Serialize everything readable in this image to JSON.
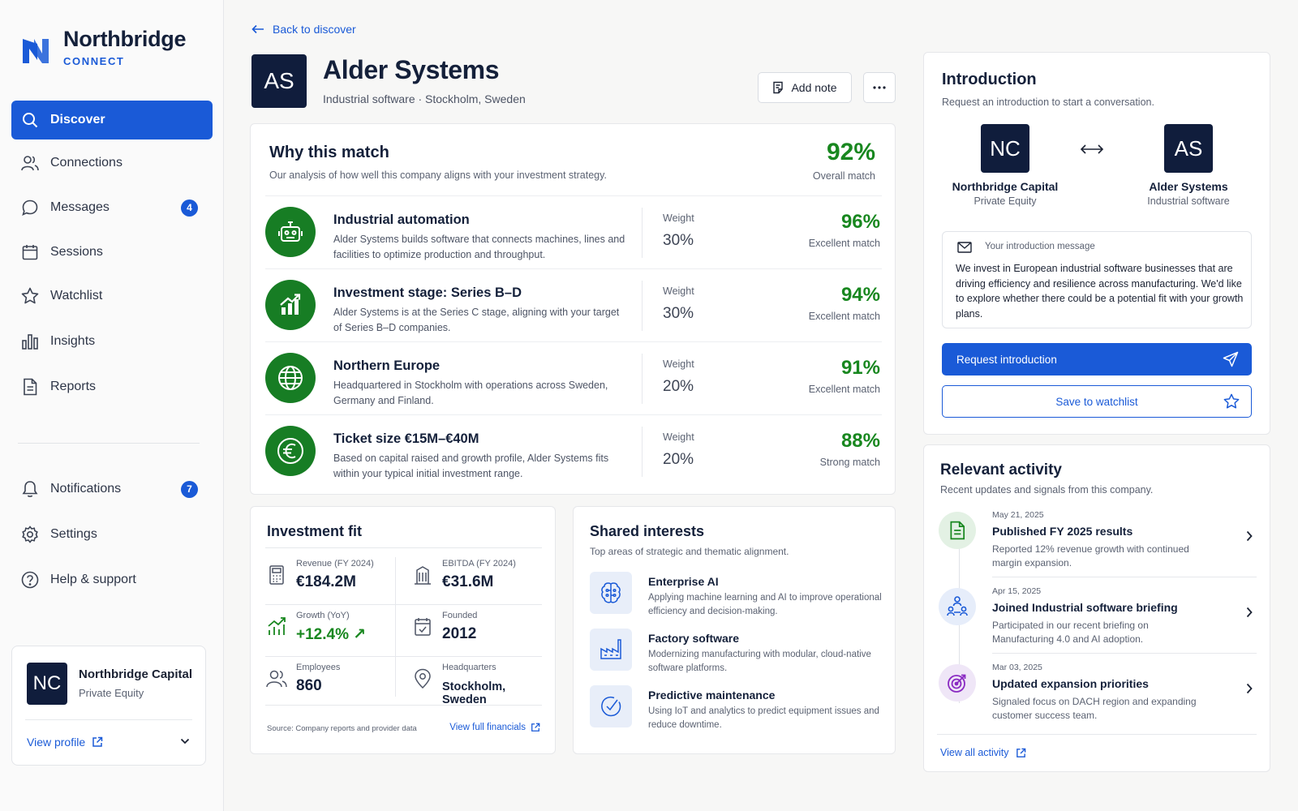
{
  "brand": {
    "name": "Northbridge",
    "sub": "CONNECT"
  },
  "nav": [
    {
      "label": "Discover",
      "icon": "search-icon"
    },
    {
      "label": "Connections",
      "icon": "users-icon"
    },
    {
      "label": "Messages",
      "icon": "chat-icon",
      "badge": "4"
    },
    {
      "label": "Sessions",
      "icon": "calendar-icon"
    },
    {
      "label": "Watchlist",
      "icon": "star-icon"
    },
    {
      "label": "Insights",
      "icon": "bar-chart-icon"
    },
    {
      "label": "Reports",
      "icon": "document-icon"
    }
  ],
  "nav_bottom": [
    {
      "label": "Notifications",
      "icon": "bell-icon",
      "badge": "7"
    },
    {
      "label": "Settings",
      "icon": "gear-icon"
    },
    {
      "label": "Help & support",
      "icon": "help-icon"
    }
  ],
  "profile": {
    "initials": "NC",
    "name": "Northbridge Capital",
    "type": "Private Equity",
    "link": "View profile"
  },
  "header": {
    "back": "Back to discover",
    "initials": "AS",
    "name": "Alder Systems",
    "meta": "Industrial software · Stockholm, Sweden",
    "add_note": "Add note"
  },
  "why": {
    "title": "Why this match",
    "subtitle": "Our analysis of how well this company aligns with your investment strategy.",
    "overall_pct": "92%",
    "overall_label": "Overall match",
    "weight_label": "Weight",
    "rows": [
      {
        "title": "Industrial automation",
        "desc": "Alder Systems builds software that connects machines, lines and facilities to optimize production and throughput.",
        "weight": "30%",
        "pct": "96%",
        "label": "Excellent match",
        "icon": "robot-icon"
      },
      {
        "title": "Investment stage: Series B–D",
        "desc": "Alder Systems is at the Series C stage, aligning with your target of Series B–D companies.",
        "weight": "30%",
        "pct": "94%",
        "label": "Excellent match",
        "icon": "growth-chart-icon"
      },
      {
        "title": "Northern Europe",
        "desc": "Headquartered in Stockholm with operations across Sweden, Germany and Finland.",
        "weight": "20%",
        "pct": "91%",
        "label": "Excellent match",
        "icon": "globe-icon"
      },
      {
        "title": "Ticket size €15M–€40M",
        "desc": "Based on capital raised and growth profile, Alder Systems fits within your typical initial investment range.",
        "weight": "20%",
        "pct": "88%",
        "label": "Strong match",
        "icon": "euro-icon"
      }
    ]
  },
  "fit": {
    "title": "Investment fit",
    "cells": [
      {
        "label": "Revenue (FY 2024)",
        "value": "€184.2M",
        "icon": "calculator-icon"
      },
      {
        "label": "EBITDA (FY 2024)",
        "value": "€31.6M",
        "icon": "building-icon"
      },
      {
        "label": "Growth (YoY)",
        "value": "+12.4% ↗",
        "icon": "growth-icon"
      },
      {
        "label": "Founded",
        "value": "2012",
        "icon": "calendar-check-icon"
      },
      {
        "label": "Employees",
        "value": "860",
        "icon": "users-icon"
      },
      {
        "label": "Headquarters",
        "value": "Stockholm, Sweden",
        "icon": "location-icon"
      }
    ],
    "source": "Source: Company reports and provider data",
    "link": "View full financials"
  },
  "shared": {
    "title": "Shared interests",
    "subtitle": "Top areas of strategic and thematic alignment.",
    "items": [
      {
        "title": "Enterprise AI",
        "desc": "Applying machine learning and AI to improve operational efficiency and decision-making.",
        "icon": "brain-icon"
      },
      {
        "title": "Factory software",
        "desc": "Modernizing manufacturing with modular, cloud-native software platforms.",
        "icon": "factory-icon"
      },
      {
        "title": "Predictive maintenance",
        "desc": "Using IoT and analytics to predict equipment issues and reduce downtime.",
        "icon": "gauge-icon"
      }
    ]
  },
  "intro": {
    "title": "Introduction",
    "subtitle": "Request an introduction to start a conversation.",
    "from": {
      "initials": "NC",
      "name": "Northbridge Capital",
      "type": "Private Equity"
    },
    "to": {
      "initials": "AS",
      "name": "Alder Systems",
      "type": "Industrial software"
    },
    "message_label": "Your introduction message",
    "message": "We invest in European industrial software businesses that are driving efficiency and resilience across manufacturing. We'd like to explore whether there could be a potential fit with your growth plans.",
    "request": "Request introduction",
    "save": "Save to watchlist"
  },
  "activity": {
    "title": "Relevant activity",
    "subtitle": "Recent updates and signals from this company.",
    "items": [
      {
        "date": "May 21, 2025",
        "title": "Published FY 2025 results",
        "desc": "Reported 12% revenue growth with continued margin expansion.",
        "icon": "document-icon"
      },
      {
        "date": "Apr 15, 2025",
        "title": "Joined Industrial software briefing",
        "desc": "Participated in our recent briefing on Manufacturing 4.0 and AI adoption.",
        "icon": "people-network-icon"
      },
      {
        "date": "Mar 03, 2025",
        "title": "Updated expansion priorities",
        "desc": "Signaled focus on DACH region and expanding customer success team.",
        "icon": "target-icon"
      }
    ],
    "link": "View all activity"
  },
  "colors": {
    "accent": "#1a5ad7",
    "success": "#18871f",
    "navy": "#101d3c"
  }
}
